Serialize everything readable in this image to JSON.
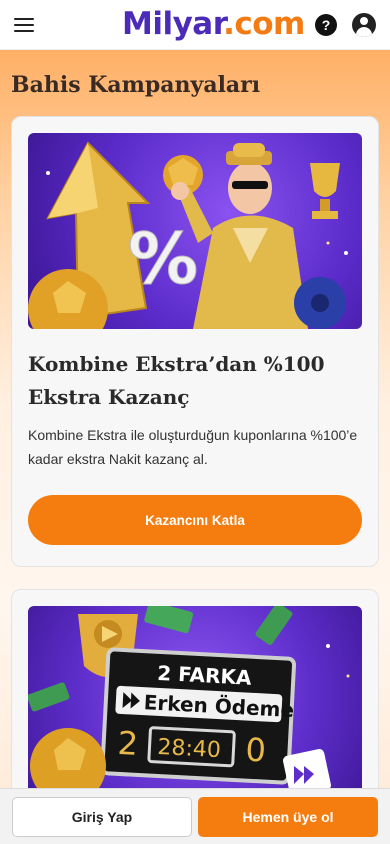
{
  "header": {
    "logo_part1": "Milyar",
    "logo_part2": ".com",
    "help_icon": "?"
  },
  "page": {
    "title": "Bahis Kampanyaları"
  },
  "campaigns": [
    {
      "title": "Kombine Ekstra’dan %100 Ekstra Kazanç",
      "description": "Kombine Ekstra ile oluşturduğun kuponlarına %100’e kadar ekstra Nakit kazanç al.",
      "cta": "Kazancını Katla",
      "banner_symbol": "%"
    },
    {
      "banner_line1": "2 FARKA",
      "banner_line2": "Erken Ödeme",
      "score_left": "2",
      "score_right": "0",
      "clock": "28:40"
    }
  ],
  "bottom_bar": {
    "login_label": "Giriş Yap",
    "register_label": "Hemen üye ol"
  },
  "colors": {
    "brand_purple": "#4b2bb8",
    "brand_orange": "#f57d10"
  }
}
